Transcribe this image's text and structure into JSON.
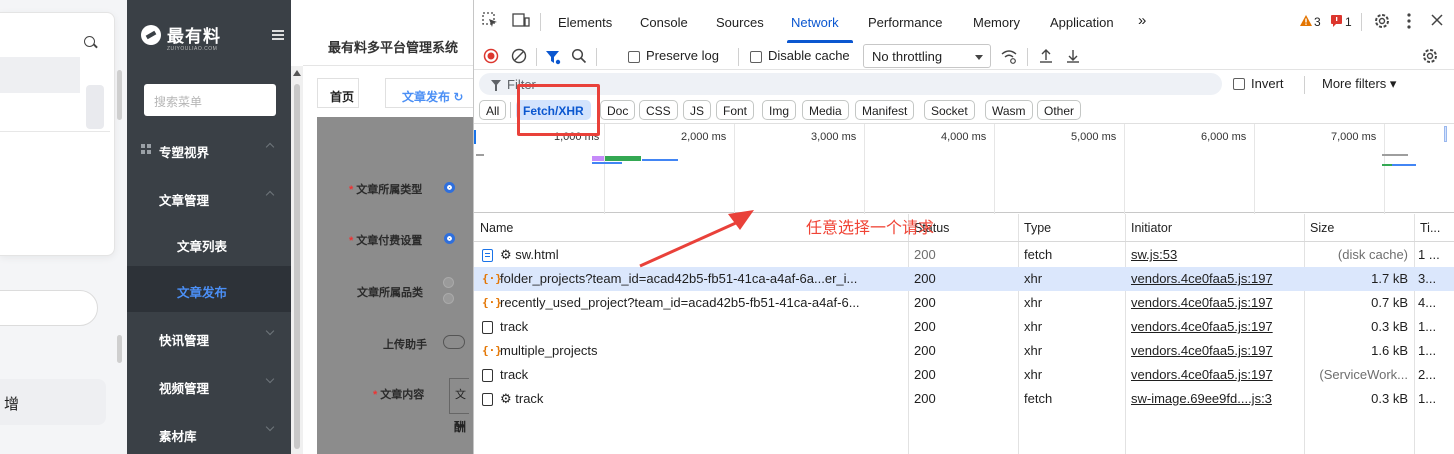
{
  "left_app": {
    "new_button_label": "增",
    "logo_text": "最有料",
    "logo_subtext": "ZUIYOULIAO.COM",
    "sidebar_search_placeholder": "搜索菜单",
    "sidebar": {
      "items": [
        {
          "label": "专塑视界"
        },
        {
          "label": "文章管理"
        },
        {
          "label": "文章列表"
        },
        {
          "label": "文章发布"
        },
        {
          "label": "快讯管理"
        },
        {
          "label": "视频管理"
        },
        {
          "label": "素材库"
        }
      ]
    },
    "main": {
      "title": "最有料多平台管理系统",
      "tabs": [
        {
          "label": "首页"
        },
        {
          "label": "文章发布 ↻"
        }
      ],
      "form_labels": [
        {
          "label": "文章所属类型",
          "required": true
        },
        {
          "label": "文章付费设置",
          "required": true
        },
        {
          "label": "文章所属品类",
          "required": false
        },
        {
          "label": "上传助手",
          "required": false
        },
        {
          "label": "文章内容",
          "required": true
        }
      ],
      "content_box_chars": [
        "文",
        "酬"
      ]
    }
  },
  "devtools": {
    "tabs": [
      "Elements",
      "Console",
      "Sources",
      "Network",
      "Performance",
      "Memory",
      "Application"
    ],
    "active_tab": "Network",
    "more_tabs": "»",
    "warnings_count": "3",
    "errors_count": "1",
    "toolbar": {
      "preserve_log": "Preserve log",
      "disable_cache": "Disable cache",
      "throttling": "No throttling"
    },
    "filter_placeholder": "Filter",
    "invert_label": "Invert",
    "more_filters_label": "More filters ▾",
    "type_filters": [
      "All",
      "Fetch/XHR",
      "Doc",
      "CSS",
      "JS",
      "Font",
      "Img",
      "Media",
      "Manifest",
      "Socket",
      "Wasm",
      "Other"
    ],
    "active_type_filter": "Fetch/XHR",
    "overview_ticks": [
      "1,000 ms",
      "2,000 ms",
      "3,000 ms",
      "4,000 ms",
      "5,000 ms",
      "6,000 ms",
      "7,000 ms"
    ],
    "columns": [
      "Name",
      "Status",
      "Type",
      "Initiator",
      "Size",
      "Ti..."
    ],
    "rows": [
      {
        "icon": "html-doc-icon",
        "name": "⚙ sw.html",
        "status": "200",
        "type": "fetch",
        "initiator": "sw.js:53",
        "size": "(disk cache)",
        "time": "1 ...",
        "status_gray": true,
        "size_gray": true
      },
      {
        "icon": "xhr-icon",
        "name": "folder_projects?team_id=acad42b5-fb51-41ca-a4af-6a...er_i...",
        "status": "200",
        "type": "xhr",
        "initiator": "vendors.4ce0faa5.js:197",
        "size": "1.7 kB",
        "time": "3...",
        "selected": true
      },
      {
        "icon": "xhr-icon",
        "name": "recently_used_project?team_id=acad42b5-fb51-41ca-a4af-6...",
        "status": "200",
        "type": "xhr",
        "initiator": "vendors.4ce0faa5.js:197",
        "size": "0.7 kB",
        "time": "4..."
      },
      {
        "icon": "doc-icon",
        "name": "track",
        "status": "200",
        "type": "xhr",
        "initiator": "vendors.4ce0faa5.js:197",
        "size": "0.3 kB",
        "time": "1..."
      },
      {
        "icon": "xhr-icon",
        "name": "multiple_projects",
        "status": "200",
        "type": "xhr",
        "initiator": "vendors.4ce0faa5.js:197",
        "size": "1.6 kB",
        "time": "1..."
      },
      {
        "icon": "doc-icon",
        "name": "track",
        "status": "200",
        "type": "xhr",
        "initiator": "vendors.4ce0faa5.js:197",
        "size": "(ServiceWork...",
        "time": "2...",
        "size_gray": true
      },
      {
        "icon": "doc-icon",
        "name": "⚙ track",
        "status": "200",
        "type": "fetch",
        "initiator": "sw-image.69ee9fd....js:3",
        "size": "0.3 kB",
        "time": "1..."
      }
    ]
  },
  "annotation": {
    "text": "任意选择一个请求",
    "color": "#f04436"
  },
  "colors": {
    "accent": "#0b57d0",
    "selected_row": "#dbe7fc",
    "sidebar_bg": "#3a4046",
    "annotation_red": "#e9413a"
  }
}
